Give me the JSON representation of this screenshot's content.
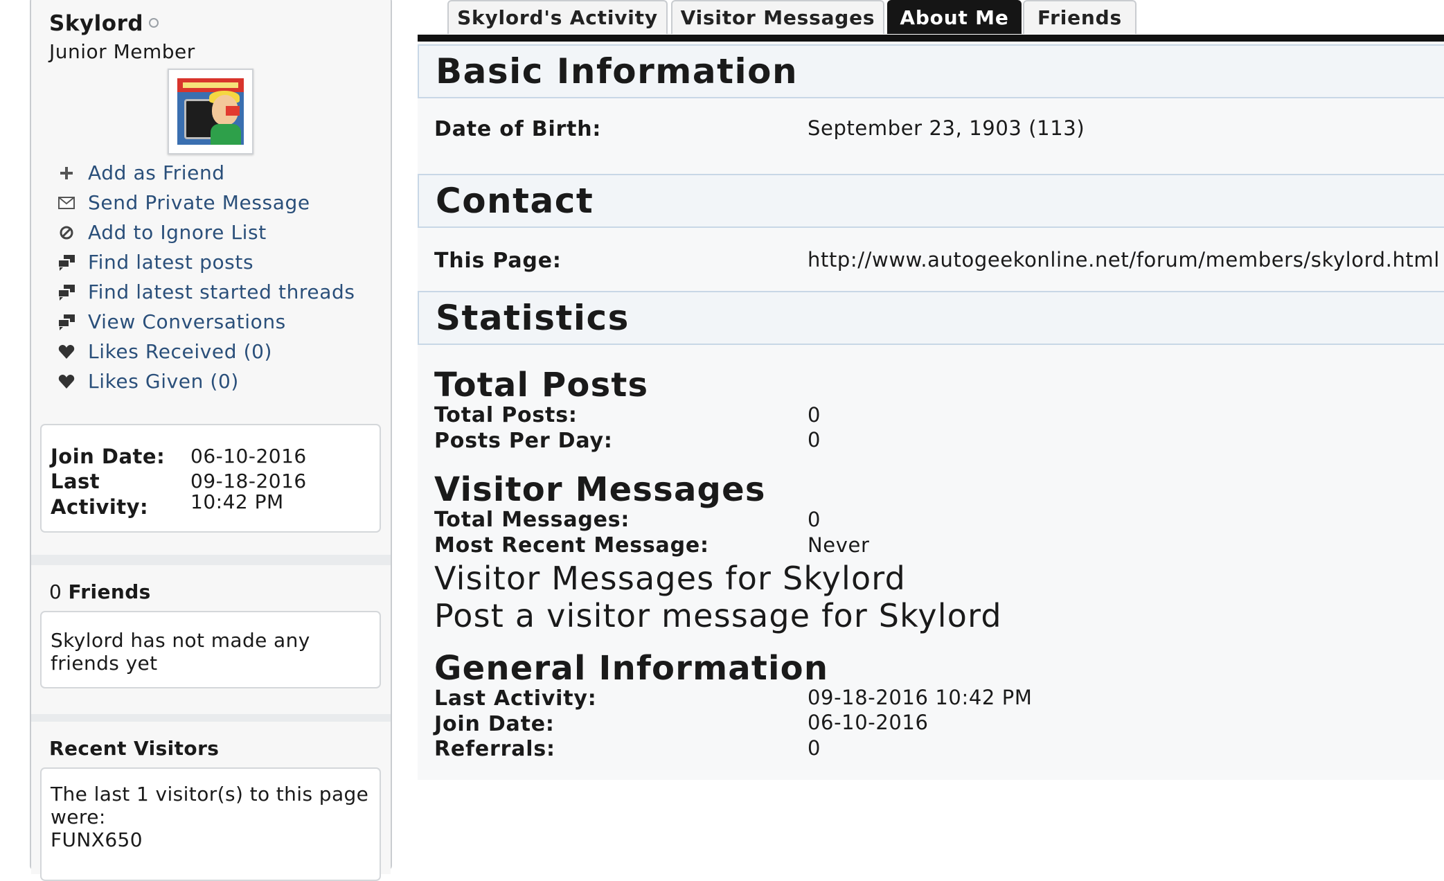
{
  "profile": {
    "username": "Skylord",
    "user_title": "Junior Member"
  },
  "actions": [
    {
      "label": "Add as Friend",
      "icon": "plus-icon"
    },
    {
      "label": "Send Private Message",
      "icon": "envelope-icon"
    },
    {
      "label": "Add to Ignore List",
      "icon": "ignore-icon"
    },
    {
      "label": "Find latest posts",
      "icon": "posts-icon"
    },
    {
      "label": "Find latest started threads",
      "icon": "threads-icon"
    },
    {
      "label": "View Conversations",
      "icon": "conversations-icon"
    },
    {
      "label": "Likes Received (0)",
      "icon": "heart-icon"
    },
    {
      "label": "Likes Given (0)",
      "icon": "heart-icon"
    }
  ],
  "join_info": {
    "join_date_label": "Join Date:",
    "join_date": "06-10-2016",
    "last_activity_label_1": "Last",
    "last_activity_label_2": "Activity:",
    "last_activity_date": "09-18-2016",
    "last_activity_time": "10:42 PM"
  },
  "friends": {
    "count": "0",
    "title": "Friends",
    "empty_text": "Skylord has not made any friends yet"
  },
  "recent_visitors": {
    "title": "Recent Visitors",
    "text": "The last 1 visitor(s) to this page were:",
    "visitor": "FUNX650"
  },
  "tabs": [
    {
      "label": "Skylord's Activity",
      "active": false
    },
    {
      "label": "Visitor Messages",
      "active": false
    },
    {
      "label": "About Me",
      "active": true
    },
    {
      "label": "Friends",
      "active": false
    }
  ],
  "basic_info": {
    "heading": "Basic Information",
    "dob_label": "Date of Birth:",
    "dob_value": "September 23, 1903 (113)"
  },
  "contact": {
    "heading": "Contact",
    "page_label": "This Page:",
    "page_value": "http://www.autogeekonline.net/forum/members/skylord.html"
  },
  "statistics": {
    "heading": "Statistics",
    "total_posts_heading": "Total Posts",
    "total_posts_label": "Total Posts:",
    "total_posts_value": "0",
    "posts_per_day_label": "Posts Per Day:",
    "posts_per_day_value": "0",
    "visitor_messages_heading": "Visitor Messages",
    "total_messages_label": "Total Messages:",
    "total_messages_value": "0",
    "most_recent_label": "Most Recent Message:",
    "most_recent_value": "Never",
    "vm_link": "Visitor Messages for Skylord",
    "post_vm_link": "Post a visitor message for Skylord",
    "general_heading": "General Information",
    "last_activity_label": "Last Activity:",
    "last_activity_value": "09-18-2016 10:42 PM",
    "join_date_label": "Join Date:",
    "join_date_value": "06-10-2016",
    "referrals_label": "Referrals:",
    "referrals_value": "0"
  },
  "colors": {
    "link": "#2a4f7a",
    "active_tab": "#151515",
    "section_border": "#c8d7e6"
  }
}
